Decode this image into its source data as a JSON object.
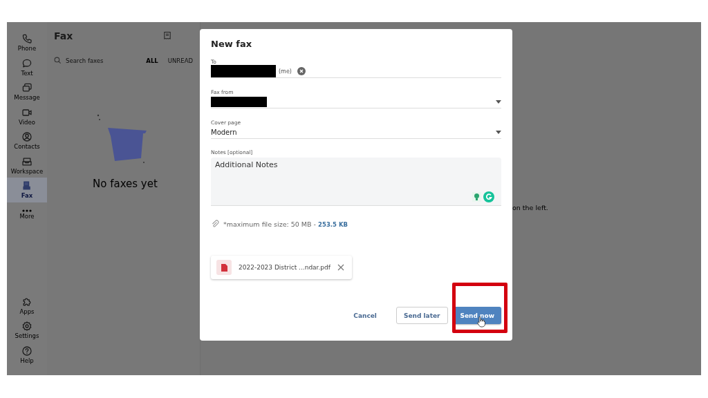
{
  "sidebar": {
    "items": [
      {
        "label": "Phone",
        "selected": false
      },
      {
        "label": "Text",
        "selected": false
      },
      {
        "label": "Message",
        "selected": false
      },
      {
        "label": "Video",
        "selected": false
      },
      {
        "label": "Contacts",
        "selected": false
      },
      {
        "label": "Workspace",
        "selected": false
      },
      {
        "label": "Fax",
        "selected": true
      },
      {
        "label": "More",
        "selected": false
      }
    ],
    "bottom_items": [
      {
        "label": "Apps"
      },
      {
        "label": "Settings"
      },
      {
        "label": "Help"
      }
    ]
  },
  "fax_list": {
    "title": "Fax",
    "search": {
      "placeholder": "Search faxes"
    },
    "filters": [
      {
        "label": "ALL",
        "selected": true
      },
      {
        "label": "UNREAD",
        "selected": false
      }
    ],
    "empty_message": "No faxes yet"
  },
  "detail_hint": "on the left.",
  "dialog": {
    "title": "New fax",
    "to": {
      "label": "To",
      "recipient_suffix": "(me)"
    },
    "fax_from": {
      "label": "Fax from"
    },
    "cover_page": {
      "label": "Cover page",
      "value": "Modern"
    },
    "notes": {
      "label": "Notes [optional]",
      "value": "Additional Notes"
    },
    "file_limit": "*maximum file size: 50 MB -",
    "attached_size": "253.5 KB",
    "attachments": [
      {
        "name": "2022-2023 District ...ndar.pdf"
      }
    ],
    "buttons": [
      {
        "label": "Cancel",
        "kind": "link",
        "highlighted": false
      },
      {
        "label": "Send later",
        "kind": "outline",
        "highlighted": false
      },
      {
        "label": "Send now",
        "kind": "primary",
        "highlighted": true
      }
    ]
  }
}
